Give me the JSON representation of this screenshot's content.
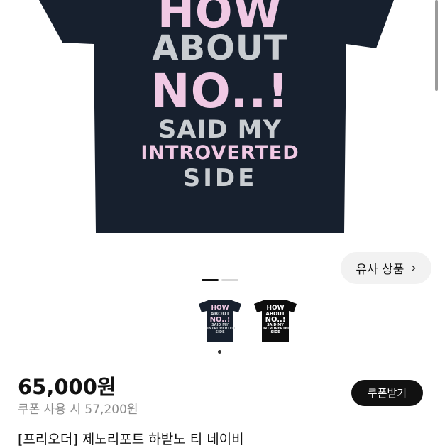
{
  "product_image": {
    "shirt_lines": [
      "HOW",
      "ABOUT",
      "NO..!",
      "SAID MY",
      "INTROVERTED",
      "SIDE"
    ],
    "shirt_color": "#17202e",
    "print_pink": "#f0c9e4",
    "print_gray": "#c9cdd1"
  },
  "similar_products": {
    "label": "유사 상품",
    "icon": "chevron-right-icon"
  },
  "thumbnails": [
    {
      "lines": [
        "HOW",
        "ABOUT",
        "NO..!",
        "SAID MY INTROVERTED SIDE"
      ],
      "color": "#17202e"
    },
    {
      "lines": [
        "HOW",
        "ABOUT",
        "NO..!",
        "SAID MY INTROVERTED SIDE"
      ],
      "color": "#0d0d0d"
    }
  ],
  "price": "65,000원",
  "coupon_price": "쿠폰 사용 시 57,200원",
  "coupon_button": "쿠폰받기",
  "title": "[프리오더] 제노리포트 하받노 티 네이비"
}
